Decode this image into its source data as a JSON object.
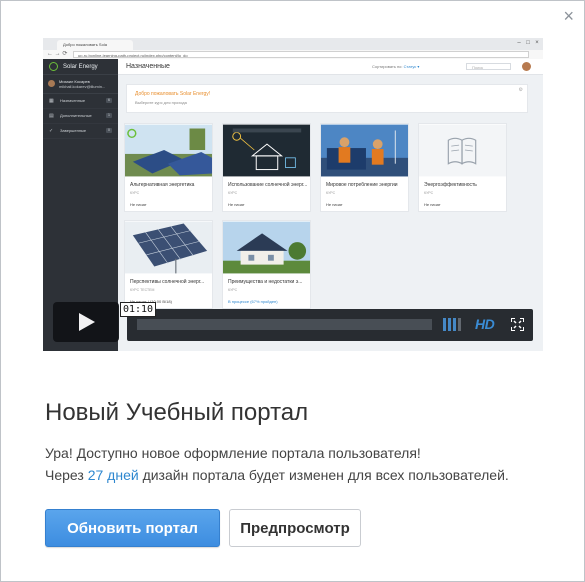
{
  "dialog": {
    "close_glyph": "×",
    "heading": "Новый Учебный портал",
    "message_line1": "Ура! Доступно новое оформление портала пользователя!",
    "message_line2_before": "Через",
    "message_line2_days": "27 дней",
    "message_line2_after": "дизайн портала будет изменен для всех пользователей.",
    "primary_button": "Обновить портал",
    "secondary_button": "Предпросмотр"
  },
  "video": {
    "current_time": "01:10",
    "quality_label": "HD",
    "browser": {
      "tab_title": "Добро пожаловать Sola",
      "url": "up-ru.bonline-learning-path-project.ru/index.php/content/lo_do"
    },
    "app": {
      "brand": "Solar Energy",
      "user_name": "Михаил Косарев",
      "user_email": "mikhail.kokarev@illumin...",
      "sidebar": [
        {
          "label": "Назначенные",
          "count": "6",
          "icon": "calendar-icon"
        },
        {
          "label": "Дополнительные",
          "count": "1",
          "icon": "document-icon"
        },
        {
          "label": "Завершенные",
          "count": "0",
          "icon": "check-icon"
        }
      ],
      "page_title": "Назначенные",
      "sort_label": "Сортировать по:",
      "sort_value": "Статус ▾",
      "search_placeholder": "Поиск",
      "welcome_title": "Добро пожаловать Solar Energy!",
      "welcome_subtitle": "Выберите курс для прохода",
      "cards": [
        {
          "title": "Альтернативная энергетика",
          "kind": "КУРС",
          "status": "Не начат",
          "thumb": "solar-panels-thumb"
        },
        {
          "title": "Использование солнечной энерг...",
          "kind": "КУРС",
          "status": "Не начат",
          "thumb": "solar-house-diagram-thumb"
        },
        {
          "title": "Мировое потребление энергии",
          "kind": "КУРС",
          "status": "Не начат",
          "thumb": "workers-solar-thumb"
        },
        {
          "title": "Энергоэффективность",
          "kind": "КУРС",
          "status": "Не начат",
          "thumb": "book-icon-thumb"
        },
        {
          "title": "Перспективы солнечной энерг...",
          "kind": "КУРС ТЕСТЕМ",
          "status": "Не начат | (10.00 B/18)",
          "thumb": "solar-array-thumb"
        },
        {
          "title": "Преимущества и недостатки э...",
          "kind": "КУРС",
          "status": "В процессе (67% пройден)",
          "thumb": "house-roof-thumb"
        }
      ]
    }
  }
}
